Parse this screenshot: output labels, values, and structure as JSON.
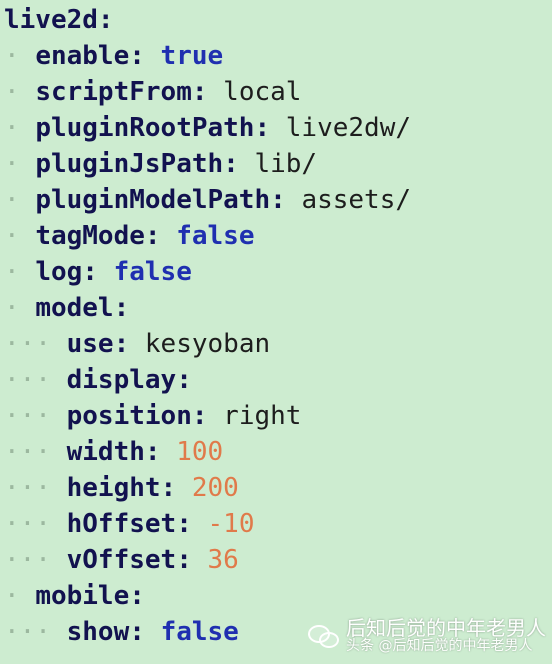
{
  "lines": [
    {
      "indent": "",
      "key": "live2d",
      "colon": ":",
      "value": "",
      "type": "none"
    },
    {
      "indent": "· ",
      "key": "enable",
      "colon": ":",
      "value": "true",
      "type": "bool"
    },
    {
      "indent": "· ",
      "key": "scriptFrom",
      "colon": ":",
      "value": "local",
      "type": "str"
    },
    {
      "indent": "· ",
      "key": "pluginRootPath",
      "colon": ":",
      "value": "live2dw/",
      "type": "str"
    },
    {
      "indent": "· ",
      "key": "pluginJsPath",
      "colon": ":",
      "value": "lib/",
      "type": "str"
    },
    {
      "indent": "· ",
      "key": "pluginModelPath",
      "colon": ":",
      "value": "assets/",
      "type": "str"
    },
    {
      "indent": "· ",
      "key": "tagMode",
      "colon": ":",
      "value": "false",
      "type": "bool"
    },
    {
      "indent": "· ",
      "key": "log",
      "colon": ":",
      "value": "false",
      "type": "bool"
    },
    {
      "indent": "· ",
      "key": "model",
      "colon": ":",
      "value": "",
      "type": "none"
    },
    {
      "indent": "··· ",
      "key": "use",
      "colon": ":",
      "value": "kesyoban",
      "type": "str"
    },
    {
      "indent": "··· ",
      "key": "display",
      "colon": ":",
      "value": "",
      "type": "none"
    },
    {
      "indent": "··· ",
      "key": "position",
      "colon": ":",
      "value": "right",
      "type": "str"
    },
    {
      "indent": "··· ",
      "key": "width",
      "colon": ":",
      "value": "100",
      "type": "num"
    },
    {
      "indent": "··· ",
      "key": "height",
      "colon": ":",
      "value": "200",
      "type": "num"
    },
    {
      "indent": "··· ",
      "key": "hOffset",
      "colon": ":",
      "value": "-10",
      "type": "num"
    },
    {
      "indent": "··· ",
      "key": "vOffset",
      "colon": ":",
      "value": "36",
      "type": "num"
    },
    {
      "indent": "· ",
      "key": "mobile",
      "colon": ":",
      "value": "",
      "type": "none"
    },
    {
      "indent": "··· ",
      "key": "show",
      "colon": ":",
      "value": "false",
      "type": "bool"
    }
  ],
  "watermark": {
    "main": "后知后觉的中年老男人",
    "sub": "头条 @后知后觉的中年老男人",
    "icon": "wechat-icon"
  }
}
